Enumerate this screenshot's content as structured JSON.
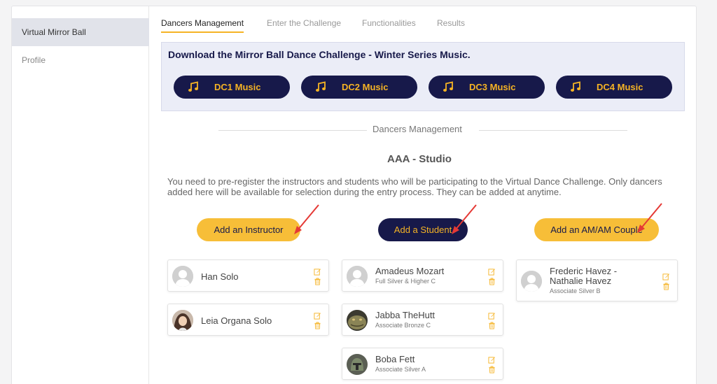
{
  "sidebar": {
    "items": [
      {
        "label": "Virtual Mirror Ball",
        "active": true
      },
      {
        "label": "Profile",
        "active": false
      }
    ]
  },
  "tabs": [
    {
      "label": "Dancers Management",
      "active": true
    },
    {
      "label": "Enter the Challenge",
      "active": false
    },
    {
      "label": "Functionalities",
      "active": false
    },
    {
      "label": "Results",
      "active": false
    }
  ],
  "download": {
    "title": "Download the Mirror Ball Dance Challenge - Winter Series Music.",
    "buttons": [
      {
        "label": "DC1 Music",
        "icon": "music-note-icon"
      },
      {
        "label": "DC2 Music",
        "icon": "music-note-icon"
      },
      {
        "label": "DC3 Music",
        "icon": "music-note-icon"
      },
      {
        "label": "DC4 Music",
        "icon": "music-note-icon"
      }
    ]
  },
  "section_title": "Dancers Management",
  "studio_name": "AAA - Studio",
  "intro_text": "You need to pre-register the instructors and students who will be participating to the Virtual Dance Challenge. Only dancers added here will be available for selection during the entry process. They can be added at anytime.",
  "actions": {
    "add_instructor": "Add an Instructor",
    "add_student": "Add a Student",
    "add_couple": "Add an AM/AM Couple"
  },
  "instructors": [
    {
      "name": "Han Solo",
      "avatar": "default-user-icon"
    },
    {
      "name": "Leia Organa Solo",
      "avatar": "photo-avatar"
    }
  ],
  "students": [
    {
      "name": "Amadeus Mozart",
      "level": "Full Silver & Higher C",
      "avatar": "default-user-icon"
    },
    {
      "name": "Jabba TheHutt",
      "level": "Associate Bronze C",
      "avatar": "photo-avatar"
    },
    {
      "name": "Boba Fett",
      "level": "Associate Silver A",
      "avatar": "photo-avatar"
    }
  ],
  "couples": [
    {
      "name_line1": "Frederic Havez -",
      "name_line2": "Nathalie Havez",
      "level": "Associate Silver B",
      "avatar": "default-user-icon"
    }
  ],
  "colors": {
    "navy": "#17194a",
    "yellow": "#f7be38",
    "accent_text": "#f5b324",
    "annotation_arrow": "#e53935"
  }
}
